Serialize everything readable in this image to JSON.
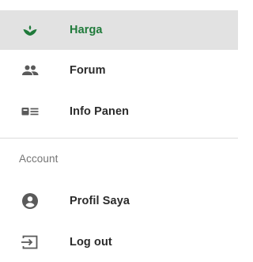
{
  "drawer": {
    "items": [
      {
        "label": "Harga",
        "icon": "sprout-icon",
        "active": true
      },
      {
        "label": "Forum",
        "icon": "people-icon",
        "active": false
      },
      {
        "label": "Info Panen",
        "icon": "article-icon",
        "active": false
      }
    ],
    "account_section": {
      "header": "Account",
      "items": [
        {
          "label": "Profil Saya",
          "icon": "account-circle-icon"
        },
        {
          "label": "Log out",
          "icon": "logout-icon"
        }
      ]
    }
  },
  "colors": {
    "accent": "#1f7a3a",
    "active_background": "#e2e2e2",
    "icon_gray": "#5a5a5a",
    "text": "#2b2b2b",
    "section_header": "#757575",
    "divider": "#dcdcdc"
  }
}
